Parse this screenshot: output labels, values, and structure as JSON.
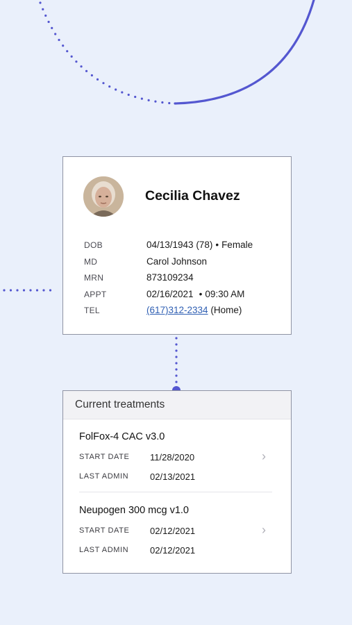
{
  "colors": {
    "accent": "#5457d0",
    "background": "#eaf0fb",
    "link": "#2f5fb3"
  },
  "patient": {
    "name": "Cecilia Chavez",
    "avatar_icon": "patient-photo",
    "rows": [
      {
        "label": "DOB",
        "value": "04/13/1943 (78)",
        "extra": "Female"
      },
      {
        "label": "MD",
        "value": "Carol Johnson"
      },
      {
        "label": "MRN",
        "value": "873109234"
      },
      {
        "label": "APPT",
        "value": "02/16/2021",
        "extra": "09:30 AM"
      },
      {
        "label": "TEL",
        "value": "(617)312-2334",
        "extra": "(Home)"
      }
    ]
  },
  "treatments": {
    "title": "Current treatments",
    "items": [
      {
        "name": "FolFox-4 CAC v3.0",
        "start_label": "START DATE",
        "start_date": "11/28/2020",
        "admin_label": "LAST ADMIN",
        "last_admin": "02/13/2021"
      },
      {
        "name": "Neupogen 300 mcg v1.0",
        "start_label": "START DATE",
        "start_date": "02/12/2021",
        "admin_label": "LAST ADMIN",
        "last_admin": "02/12/2021"
      }
    ],
    "chevron_icon": "chevron-right-icon"
  }
}
